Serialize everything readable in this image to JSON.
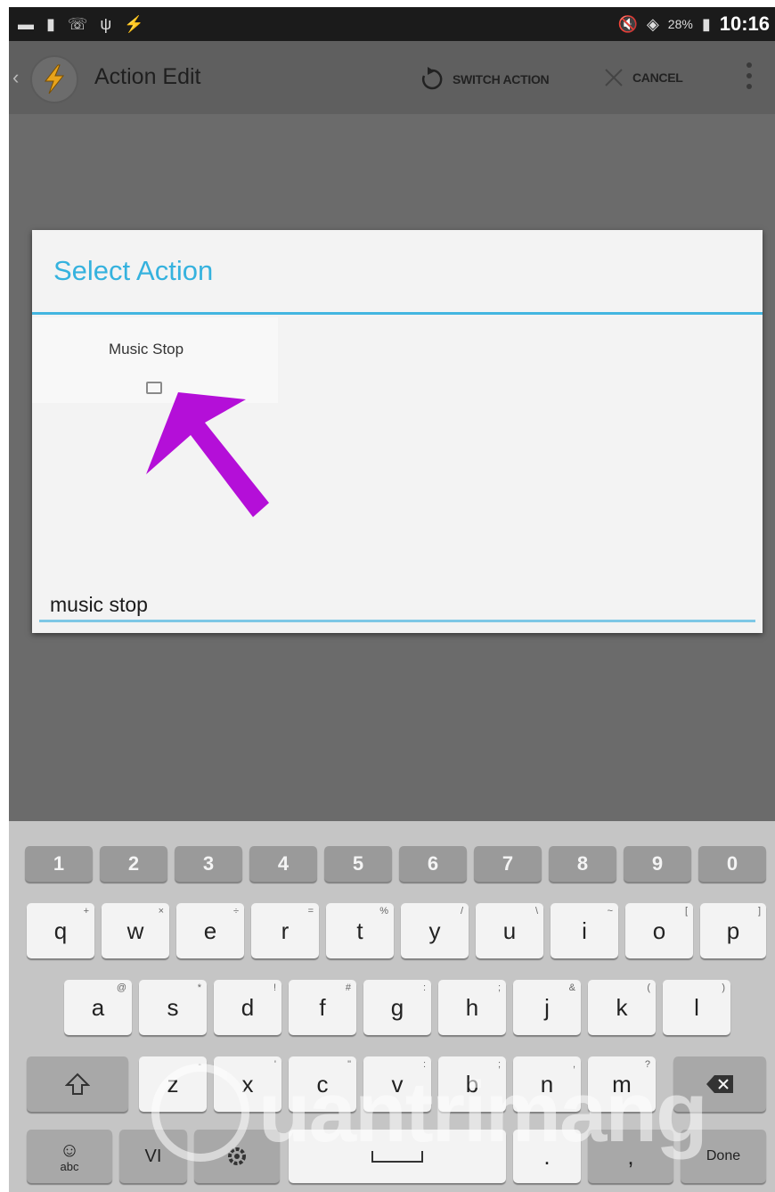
{
  "status_bar": {
    "battery_percent": "28%",
    "time": "10:16"
  },
  "action_bar": {
    "title": "Action Edit",
    "switch_action_label": "SWITCH ACTION",
    "cancel_label": "CANCEL"
  },
  "dialog": {
    "title": "Select  Action",
    "item_label": "Music Stop",
    "search_value": "music stop"
  },
  "keyboard": {
    "number_row": [
      "1",
      "2",
      "3",
      "4",
      "5",
      "6",
      "7",
      "8",
      "9",
      "0"
    ],
    "row_q": [
      {
        "key": "q",
        "sub": "+"
      },
      {
        "key": "w",
        "sub": "×"
      },
      {
        "key": "e",
        "sub": "÷"
      },
      {
        "key": "r",
        "sub": "="
      },
      {
        "key": "t",
        "sub": "%"
      },
      {
        "key": "y",
        "sub": "/"
      },
      {
        "key": "u",
        "sub": "\\"
      },
      {
        "key": "i",
        "sub": "~"
      },
      {
        "key": "o",
        "sub": "["
      },
      {
        "key": "p",
        "sub": "]"
      }
    ],
    "row_a": [
      {
        "key": "a",
        "sub": "@"
      },
      {
        "key": "s",
        "sub": "*"
      },
      {
        "key": "d",
        "sub": "!"
      },
      {
        "key": "f",
        "sub": "#"
      },
      {
        "key": "g",
        "sub": ":"
      },
      {
        "key": "h",
        "sub": ";"
      },
      {
        "key": "j",
        "sub": "&"
      },
      {
        "key": "k",
        "sub": "("
      },
      {
        "key": "l",
        "sub": ")"
      }
    ],
    "row_z": [
      {
        "key": "z",
        "sub": "-"
      },
      {
        "key": "x",
        "sub": "'"
      },
      {
        "key": "c",
        "sub": "\""
      },
      {
        "key": "v",
        "sub": ":"
      },
      {
        "key": "b",
        "sub": ";"
      },
      {
        "key": "n",
        "sub": ","
      },
      {
        "key": "m",
        "sub": "?"
      }
    ],
    "lang_label": "VI",
    "done_label": "Done",
    "emoji_label": "abc"
  },
  "watermark": {
    "text": "uantrimang"
  },
  "colors": {
    "accent": "#35b2de",
    "arrow": "#b40fd8"
  }
}
